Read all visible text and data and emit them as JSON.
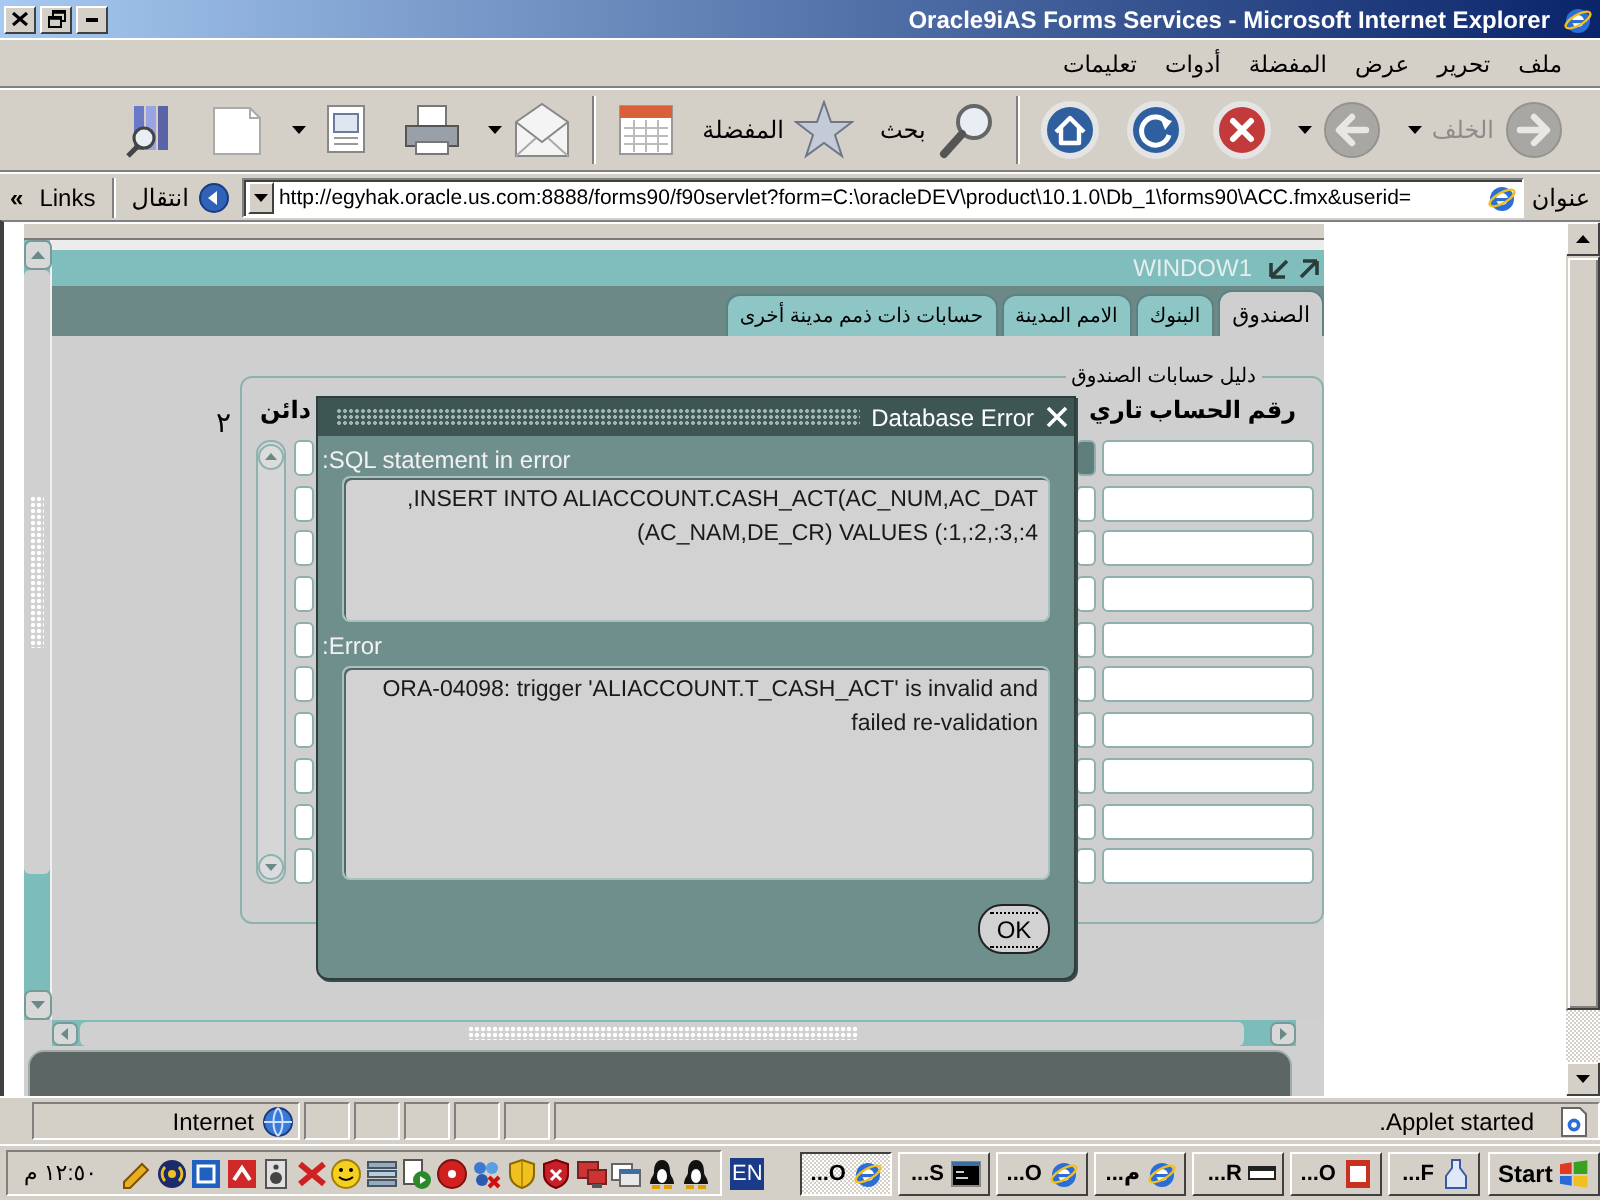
{
  "window": {
    "title": "Oracle9iAS Forms Services - Microsoft Internet Explorer"
  },
  "menu": [
    {
      "label": "ملف"
    },
    {
      "label": "تحرير"
    },
    {
      "label": "عرض"
    },
    {
      "label": "المفضلة"
    },
    {
      "label": "أدوات"
    },
    {
      "label": "تعليمات"
    }
  ],
  "toolbar": {
    "groups": [
      {
        "items": [
          {
            "kind": "back",
            "label": "الخلف",
            "disabled": true,
            "dropdown": true
          },
          {
            "kind": "forward",
            "disabled": true,
            "dropdown": true
          },
          {
            "kind": "stop",
            "disabled": false,
            "dropdown": false
          },
          {
            "kind": "refresh",
            "disabled": false,
            "dropdown": false
          },
          {
            "kind": "home",
            "disabled": false,
            "dropdown": false
          }
        ]
      },
      {
        "items": [
          {
            "kind": "search",
            "label": "بحث",
            "disabled": false,
            "dropdown": false
          },
          {
            "kind": "favorites",
            "label": "المفضلة",
            "disabled": false,
            "dropdown": false
          },
          {
            "kind": "history",
            "disabled": false,
            "dropdown": false
          }
        ]
      },
      {
        "items": [
          {
            "kind": "mail",
            "disabled": false,
            "dropdown": true
          },
          {
            "kind": "print",
            "disabled": false,
            "dropdown": false
          },
          {
            "kind": "edit",
            "disabled": false,
            "dropdown": true
          },
          {
            "kind": "page",
            "disabled": false,
            "dropdown": false
          },
          {
            "kind": "research",
            "disabled": false,
            "dropdown": false
          }
        ]
      }
    ]
  },
  "address_bar": {
    "label": "عنوان",
    "url": "http://egyhak.oracle.us.com:8888/forms90/f90servlet?form=C:\\oracleDEV\\product\\10.1.0\\Db_1\\forms90\\ACC.fmx&userid=",
    "go": "انتقال",
    "links": "Links",
    "chevron": "«"
  },
  "applet": {
    "window_title": "WINDOW1",
    "tabs": [
      {
        "label": "الصندوق",
        "selected": true
      },
      {
        "label": "البنوك",
        "selected": false
      },
      {
        "label": "الامم المدينة",
        "selected": false
      },
      {
        "label": "حسابات ذات ذمم مدينة أخرى",
        "selected": false
      }
    ],
    "frame_title": "دليل حسابات الصندوق",
    "headers": {
      "column_1": "رقم الحساب",
      "column_2": "تاري",
      "column_3": "دائن"
    },
    "side_label": "٢",
    "rows": [
      {
        "current": true
      },
      {
        "current": false
      },
      {
        "current": false
      },
      {
        "current": false
      },
      {
        "current": false
      },
      {
        "current": false
      },
      {
        "current": false
      },
      {
        "current": false
      },
      {
        "current": false
      },
      {
        "current": false
      }
    ]
  },
  "dialog": {
    "title": "Database Error",
    "sections": [
      {
        "label": ":SQL statement in error",
        "lines": [
          ",INSERT INTO ALIACCOUNT.CASH_ACT(AC_NUM,AC_DAT",
          "(AC_NAM,DE_CR) VALUES (:1,:2,:3,:4"
        ]
      },
      {
        "label": ":Error",
        "lines": [
          "ORA-04098: trigger 'ALIACCOUNT.T_CASH_ACT' is invalid and",
          "failed re-validation"
        ]
      }
    ],
    "button": "OK"
  },
  "status_bar": {
    "message": ".Applet started",
    "zone": "Internet"
  },
  "taskbar": {
    "start": "Start",
    "buttons": [
      {
        "label": "...F",
        "kind": "bottle",
        "selected": false
      },
      {
        "label": "...O",
        "kind": "document",
        "selected": false
      },
      {
        "label": "...R",
        "kind": "window",
        "selected": false
      },
      {
        "label": "...م",
        "kind": "browser",
        "selected": false
      },
      {
        "label": "...O",
        "kind": "browser",
        "selected": false
      },
      {
        "label": "...S",
        "kind": "console",
        "selected": false
      },
      {
        "label": "...O",
        "kind": "browser",
        "selected": true
      }
    ],
    "language": "EN",
    "clock": "١٢:٥٠ م"
  }
}
